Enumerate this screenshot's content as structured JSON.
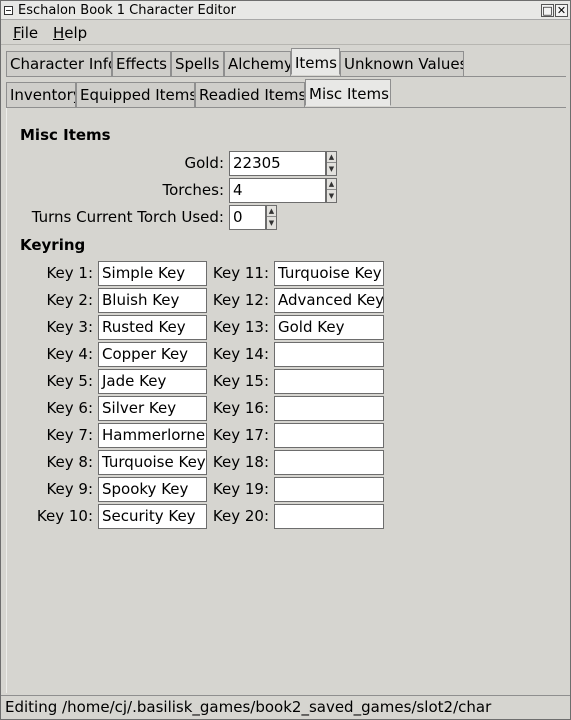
{
  "window": {
    "title": "Eschalon Book 1 Character Editor"
  },
  "menubar": {
    "file": {
      "underline": "F",
      "rest": "ile"
    },
    "help": {
      "underline": "H",
      "rest": "elp"
    }
  },
  "main_tabs": [
    "Character Info",
    "Effects",
    "Spells",
    "Alchemy",
    "Items",
    "Unknown Values"
  ],
  "sub_tabs": [
    "Inventory",
    "Equipped Items",
    "Readied Items",
    "Misc Items"
  ],
  "misc": {
    "heading": "Misc Items",
    "gold_label": "Gold:",
    "gold_value": "22305",
    "torches_label": "Torches:",
    "torches_value": "4",
    "torch_used_label": "Turns Current Torch Used:",
    "torch_used_value": "0"
  },
  "keyring": {
    "heading": "Keyring",
    "left": [
      {
        "label": "Key 1:",
        "value": "Simple Key"
      },
      {
        "label": "Key 2:",
        "value": "Bluish Key"
      },
      {
        "label": "Key 3:",
        "value": "Rusted Key"
      },
      {
        "label": "Key 4:",
        "value": "Copper Key"
      },
      {
        "label": "Key 5:",
        "value": "Jade Key"
      },
      {
        "label": "Key 6:",
        "value": "Silver Key"
      },
      {
        "label": "Key 7:",
        "value": "Hammerlorne Key"
      },
      {
        "label": "Key 8:",
        "value": "Turquoise Key"
      },
      {
        "label": "Key 9:",
        "value": "Spooky Key"
      },
      {
        "label": "Key 10:",
        "value": "Security Key"
      }
    ],
    "right": [
      {
        "label": "Key 11:",
        "value": "Turquoise Key"
      },
      {
        "label": "Key 12:",
        "value": "Advanced Key"
      },
      {
        "label": "Key 13:",
        "value": "Gold Key"
      },
      {
        "label": "Key 14:",
        "value": ""
      },
      {
        "label": "Key 15:",
        "value": ""
      },
      {
        "label": "Key 16:",
        "value": ""
      },
      {
        "label": "Key 17:",
        "value": ""
      },
      {
        "label": "Key 18:",
        "value": ""
      },
      {
        "label": "Key 19:",
        "value": ""
      },
      {
        "label": "Key 20:",
        "value": ""
      }
    ]
  },
  "status": {
    "text": "Editing /home/cj/.basilisk_games/book2_saved_games/slot2/char"
  }
}
